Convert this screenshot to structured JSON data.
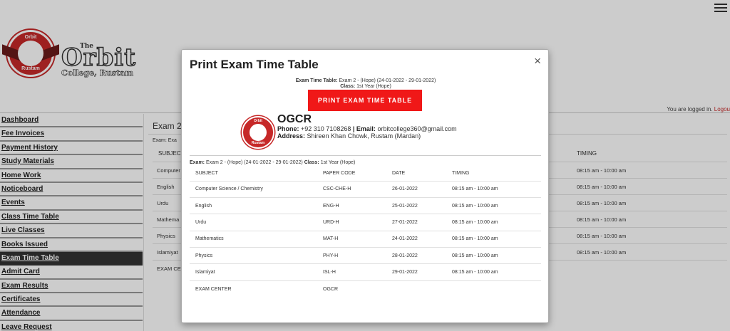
{
  "logo": {
    "badge_top": "Orbit",
    "badge_bottom": "Rustam",
    "small": "The",
    "main": "Orbit",
    "sub": "College, Rustam"
  },
  "login": {
    "text": "You are logged in.",
    "logout": "Logou"
  },
  "sidebar": {
    "items": [
      {
        "label": "Dashboard"
      },
      {
        "label": "Fee Invoices"
      },
      {
        "label": "Payment History"
      },
      {
        "label": "Study Materials"
      },
      {
        "label": "Home Work"
      },
      {
        "label": "Noticeboard"
      },
      {
        "label": "Events"
      },
      {
        "label": "Class Time Table"
      },
      {
        "label": "Live Classes"
      },
      {
        "label": "Books Issued"
      },
      {
        "label": "Exam Time Table"
      },
      {
        "label": "Admit Card"
      },
      {
        "label": "Exam Results"
      },
      {
        "label": "Certificates"
      },
      {
        "label": "Attendance"
      },
      {
        "label": "Leave Request"
      }
    ]
  },
  "content": {
    "title": "Exam 2 -",
    "exam_line": "Exam: Exa",
    "head_subject": "SUBJECT",
    "head_timing": "TIMING",
    "rows": [
      {
        "subject": "Computer",
        "timing": "08:15 am - 10:00 am"
      },
      {
        "subject": "English",
        "timing": "08:15 am - 10:00 am"
      },
      {
        "subject": "Urdu",
        "timing": "08:15 am - 10:00 am"
      },
      {
        "subject": "Mathema",
        "timing": "08:15 am - 10:00 am"
      },
      {
        "subject": "Physics",
        "timing": "08:15 am - 10:00 am"
      },
      {
        "subject": "Islamiyat",
        "timing": "08:15 am - 10:00 am"
      },
      {
        "subject": "EXAM CEN",
        "timing": ""
      }
    ]
  },
  "modal": {
    "title": "Print Exam Time Table",
    "close": "×",
    "meta_exam_label": "Exam Time Table:",
    "meta_exam_value": "Exam 2 - (Hope) (24-01-2022 - 29-01-2022)",
    "meta_class_label": "Class:",
    "meta_class_value": "1st Year (Hope)",
    "print_button": "PRINT EXAM TIME TABLE",
    "org_name": "OGCR",
    "phone_label": "Phone:",
    "phone_value": "+92 310 7108268",
    "sep": "|",
    "email_label": "Email:",
    "email_value": "orbitcollege360@gmail.com",
    "address_label": "Address:",
    "address_value": "Shireen Khan Chowk, Rustam (Mardan)",
    "exam_label": "Exam:",
    "exam_value": "Exam 2 - (Hope) (24-01-2022 - 29-01-2022)",
    "class_label": "Class:",
    "class_value": "1st Year (Hope)",
    "columns": [
      "SUBJECT",
      "PAPER CODE",
      "DATE",
      "TIMING"
    ],
    "rows": [
      {
        "subject": "Computer Science / Chemistry",
        "code": "CSC-CHE-H",
        "date": "26-01-2022",
        "timing": "08:15 am - 10:00 am"
      },
      {
        "subject": "English",
        "code": "ENG-H",
        "date": "25-01-2022",
        "timing": "08:15 am - 10:00 am"
      },
      {
        "subject": "Urdu",
        "code": "URD-H",
        "date": "27-01-2022",
        "timing": "08:15 am - 10:00 am"
      },
      {
        "subject": "Mathematics",
        "code": "MAT-H",
        "date": "24-01-2022",
        "timing": "08:15 am - 10:00 am"
      },
      {
        "subject": "Physics",
        "code": "PHY-H",
        "date": "28-01-2022",
        "timing": "08:15 am - 10:00 am"
      },
      {
        "subject": "Islamiyat",
        "code": "ISL-H",
        "date": "29-01-2022",
        "timing": "08:15 am - 10:00 am"
      },
      {
        "subject": "EXAM CENTER",
        "code": "OGCR",
        "date": "",
        "timing": ""
      }
    ]
  },
  "colors": {
    "accent": "#f01818",
    "logo_red": "#c62828",
    "active_nav": "#333333"
  }
}
